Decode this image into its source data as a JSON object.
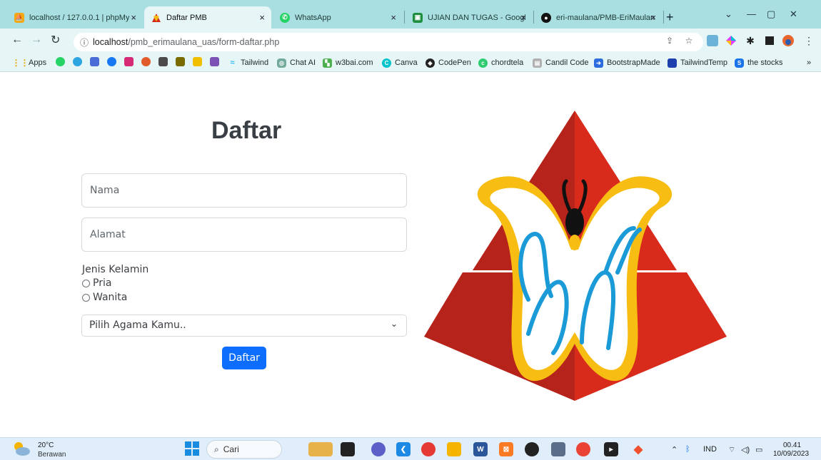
{
  "browser": {
    "tabs": [
      {
        "title": "localhost / 127.0.0.1 | phpMy",
        "icon": "phpmyadmin-icon",
        "active": false
      },
      {
        "title": "Daftar PMB",
        "icon": "butterfly-logo-icon",
        "active": true
      },
      {
        "title": "WhatsApp",
        "icon": "whatsapp-icon",
        "active": false
      },
      {
        "title": "UJIAN DAN TUGAS - Google",
        "icon": "google-classroom-icon",
        "active": false
      },
      {
        "title": "eri-maulana/PMB-EriMaulan",
        "icon": "github-icon",
        "active": false
      }
    ],
    "tab_close_glyph": "×",
    "new_tab_glyph": "+",
    "window_controls": [
      "⌄",
      "—",
      "▢",
      "✕"
    ],
    "url_host": "localhost",
    "url_path": "/pmb_erimaulana_uas/form-daftar.php",
    "bookmarks": [
      {
        "label": "Apps",
        "icon": "apps-grid-icon",
        "color": "#e8a300"
      },
      {
        "label": "Tailwind",
        "icon": "tailwind-icon",
        "color": "#38bdf8"
      },
      {
        "label": "Chat AI",
        "icon": "chat-ai-icon",
        "color": "#74aa9c"
      },
      {
        "label": "w3bai.com",
        "icon": "w3bai-icon",
        "color": "#4caf50"
      },
      {
        "label": "Canva",
        "icon": "canva-icon",
        "color": "#00c4cc"
      },
      {
        "label": "CodePen",
        "icon": "codepen-icon",
        "color": "#222222"
      },
      {
        "label": "chordtela",
        "icon": "chordtela-icon",
        "color": "#2ecc71"
      },
      {
        "label": "Candil Code",
        "icon": "candil-code-icon",
        "color": "#b0b0b0"
      },
      {
        "label": "BootstrapMade",
        "icon": "bootstrapmade-icon",
        "color": "#2d6cdf"
      },
      {
        "label": "TailwindTemp",
        "icon": "tailwindtemp-icon",
        "color": "#1e40af"
      },
      {
        "label": "the stocks",
        "icon": "the-stocks-icon",
        "color": "#1a73e8"
      }
    ],
    "bookmarks_overflow": "»"
  },
  "form": {
    "title": "Daftar",
    "name_placeholder": "Nama",
    "address_placeholder": "Alamat",
    "gender_label": "Jenis Kelamin",
    "gender_options": [
      "Pria",
      "Wanita"
    ],
    "religion_placeholder": "Pilih Agama Kamu..",
    "submit_label": "Daftar"
  },
  "taskbar": {
    "weather_temp": "20°C",
    "weather_condition": "Berawan",
    "search_placeholder": "Cari",
    "language": "IND",
    "time": "00.41",
    "date": "10/09/2023"
  },
  "colors": {
    "accent": "#0d6efd",
    "tabstrip": "#a9dfe0",
    "toolbar": "#e6f5f5",
    "logo_red": "#d42a1c",
    "logo_yellow": "#f7bd12",
    "logo_blue": "#1a9ad6"
  }
}
